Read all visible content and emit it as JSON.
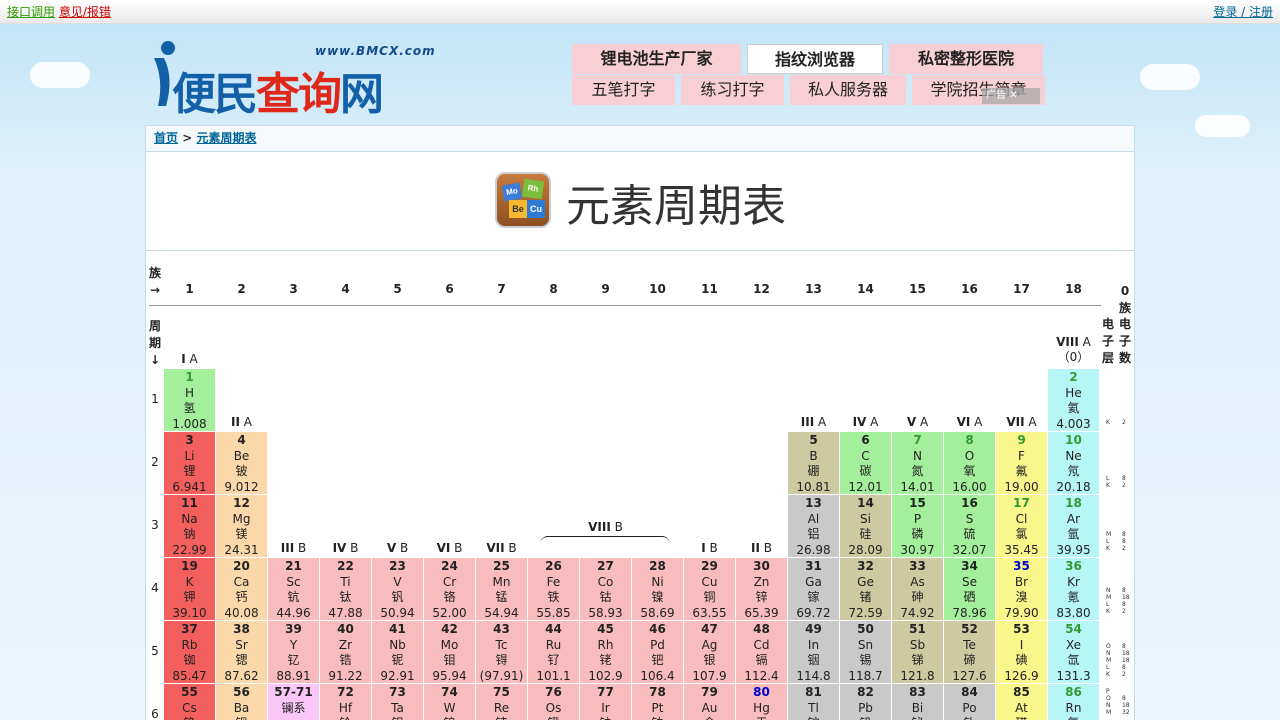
{
  "topbar": {
    "api": "接口调用",
    "feedback": "意见/报错",
    "login": "登录 / 注册"
  },
  "logo": {
    "url": "www.BMCX.com",
    "name_a": "便民",
    "name_b": "查询",
    "name_c": "网"
  },
  "nav": {
    "row1": [
      "锂电池生产厂家",
      "指纹浏览器",
      "私密整形医院"
    ],
    "row2": [
      "五笔打字",
      "练习打字",
      "私人服务器",
      "学院招生简章"
    ],
    "ad_badge": "广告"
  },
  "breadcrumb": {
    "home": "首页",
    "sep": ">",
    "current": "元素周期表"
  },
  "page": {
    "title": "元素周期表"
  },
  "table": {
    "family_label": "族",
    "arrow_right": "→",
    "period_label": "周期",
    "arrow_down": "↓",
    "groups": [
      "1",
      "2",
      "3",
      "4",
      "5",
      "6",
      "7",
      "8",
      "9",
      "10",
      "11",
      "12",
      "13",
      "14",
      "15",
      "16",
      "17",
      "18"
    ],
    "zero_group": "0族",
    "shell_label": "电子层",
    "electron_label": "电子数",
    "group_names": {
      "IA": "I A",
      "IIA": "II A",
      "IIIA": "III A",
      "IVA": "IV A",
      "VA": "V A",
      "VIA": "VI A",
      "VIIA": "VII A",
      "VIIIA": "VIII A",
      "zero": "（0）",
      "IIIB": "III B",
      "IVB": "IV B",
      "VB": "V B",
      "VIB": "VI B",
      "VIIB": "VII B",
      "VIIIB": "VIII B",
      "IB": "I B",
      "IIB": "II B"
    },
    "periods": [
      "1",
      "2",
      "3",
      "4",
      "5",
      "6"
    ],
    "shells": [
      {
        "letters": "K",
        "counts": "2"
      },
      {
        "letters": "L\nK",
        "counts": "8\n2"
      },
      {
        "letters": "M\nL\nK",
        "counts": "8\n8\n2"
      },
      {
        "letters": "N\nM\nL\nK",
        "counts": "8\n18\n8\n2"
      },
      {
        "letters": "O\nN\nM\nL\nK",
        "counts": "8\n18\n18\n8\n2"
      },
      {
        "letters": "P\nO\nN\nM",
        "counts": "8\n18\n32"
      }
    ],
    "elements": [
      {
        "n": "1",
        "s": "H",
        "c": "氢",
        "m": "1.008",
        "row": 1,
        "col": 1,
        "bg": "#a4ef9b",
        "nc": "#393"
      },
      {
        "n": "2",
        "s": "He",
        "c": "氦",
        "m": "4.003",
        "row": 1,
        "col": 18,
        "bg": "#b6f6f7",
        "nc": "#393"
      },
      {
        "n": "3",
        "s": "Li",
        "c": "锂",
        "m": "6.941",
        "row": 2,
        "col": 1,
        "bg": "#f35f5d",
        "nc": "#222"
      },
      {
        "n": "4",
        "s": "Be",
        "c": "铍",
        "m": "9.012",
        "row": 2,
        "col": 2,
        "bg": "#fbd8a9",
        "nc": "#222"
      },
      {
        "n": "5",
        "s": "B",
        "c": "硼",
        "m": "10.81",
        "row": 2,
        "col": 13,
        "bg": "#cdc9a0",
        "nc": "#222"
      },
      {
        "n": "6",
        "s": "C",
        "c": "碳",
        "m": "12.01",
        "row": 2,
        "col": 14,
        "bg": "#a4ef9b",
        "nc": "#222"
      },
      {
        "n": "7",
        "s": "N",
        "c": "氮",
        "m": "14.01",
        "row": 2,
        "col": 15,
        "bg": "#a4ef9b",
        "nc": "#393"
      },
      {
        "n": "8",
        "s": "O",
        "c": "氧",
        "m": "16.00",
        "row": 2,
        "col": 16,
        "bg": "#a4ef9b",
        "nc": "#393"
      },
      {
        "n": "9",
        "s": "F",
        "c": "氟",
        "m": "19.00",
        "row": 2,
        "col": 17,
        "bg": "#f9f78c",
        "nc": "#393"
      },
      {
        "n": "10",
        "s": "Ne",
        "c": "氖",
        "m": "20.18",
        "row": 2,
        "col": 18,
        "bg": "#b6f6f7",
        "nc": "#393"
      },
      {
        "n": "11",
        "s": "Na",
        "c": "钠",
        "m": "22.99",
        "row": 3,
        "col": 1,
        "bg": "#f35f5d",
        "nc": "#222"
      },
      {
        "n": "12",
        "s": "Mg",
        "c": "镁",
        "m": "24.31",
        "row": 3,
        "col": 2,
        "bg": "#fbd8a9",
        "nc": "#222"
      },
      {
        "n": "13",
        "s": "Al",
        "c": "铝",
        "m": "26.98",
        "row": 3,
        "col": 13,
        "bg": "#c9c9c9",
        "nc": "#222"
      },
      {
        "n": "14",
        "s": "Si",
        "c": "硅",
        "m": "28.09",
        "row": 3,
        "col": 14,
        "bg": "#cdc9a0",
        "nc": "#222"
      },
      {
        "n": "15",
        "s": "P",
        "c": "磷",
        "m": "30.97",
        "row": 3,
        "col": 15,
        "bg": "#a4ef9b",
        "nc": "#222"
      },
      {
        "n": "16",
        "s": "S",
        "c": "硫",
        "m": "32.07",
        "row": 3,
        "col": 16,
        "bg": "#a4ef9b",
        "nc": "#222"
      },
      {
        "n": "17",
        "s": "Cl",
        "c": "氯",
        "m": "35.45",
        "row": 3,
        "col": 17,
        "bg": "#f9f78c",
        "nc": "#393"
      },
      {
        "n": "18",
        "s": "Ar",
        "c": "氩",
        "m": "39.95",
        "row": 3,
        "col": 18,
        "bg": "#b6f6f7",
        "nc": "#393"
      },
      {
        "n": "19",
        "s": "K",
        "c": "钾",
        "m": "39.10",
        "row": 4,
        "col": 1,
        "bg": "#f35f5d",
        "nc": "#222"
      },
      {
        "n": "20",
        "s": "Ca",
        "c": "钙",
        "m": "40.08",
        "row": 4,
        "col": 2,
        "bg": "#fbd8a9",
        "nc": "#222"
      },
      {
        "n": "21",
        "s": "Sc",
        "c": "钪",
        "m": "44.96",
        "row": 4,
        "col": 3,
        "bg": "#f9bcbc",
        "nc": "#222"
      },
      {
        "n": "22",
        "s": "Ti",
        "c": "钛",
        "m": "47.88",
        "row": 4,
        "col": 4,
        "bg": "#f9bcbc",
        "nc": "#222"
      },
      {
        "n": "23",
        "s": "V",
        "c": "钒",
        "m": "50.94",
        "row": 4,
        "col": 5,
        "bg": "#f9bcbc",
        "nc": "#222"
      },
      {
        "n": "24",
        "s": "Cr",
        "c": "铬",
        "m": "52.00",
        "row": 4,
        "col": 6,
        "bg": "#f9bcbc",
        "nc": "#222"
      },
      {
        "n": "25",
        "s": "Mn",
        "c": "锰",
        "m": "54.94",
        "row": 4,
        "col": 7,
        "bg": "#f9bcbc",
        "nc": "#222"
      },
      {
        "n": "26",
        "s": "Fe",
        "c": "铁",
        "m": "55.85",
        "row": 4,
        "col": 8,
        "bg": "#f9bcbc",
        "nc": "#222"
      },
      {
        "n": "27",
        "s": "Co",
        "c": "钴",
        "m": "58.93",
        "row": 4,
        "col": 9,
        "bg": "#f9bcbc",
        "nc": "#222"
      },
      {
        "n": "28",
        "s": "Ni",
        "c": "镍",
        "m": "58.69",
        "row": 4,
        "col": 10,
        "bg": "#f9bcbc",
        "nc": "#222"
      },
      {
        "n": "29",
        "s": "Cu",
        "c": "铜",
        "m": "63.55",
        "row": 4,
        "col": 11,
        "bg": "#f9bcbc",
        "nc": "#222"
      },
      {
        "n": "30",
        "s": "Zn",
        "c": "锌",
        "m": "65.39",
        "row": 4,
        "col": 12,
        "bg": "#f9bcbc",
        "nc": "#222"
      },
      {
        "n": "31",
        "s": "Ga",
        "c": "镓",
        "m": "69.72",
        "row": 4,
        "col": 13,
        "bg": "#c9c9c9",
        "nc": "#222"
      },
      {
        "n": "32",
        "s": "Ge",
        "c": "锗",
        "m": "72.59",
        "row": 4,
        "col": 14,
        "bg": "#cdc9a0",
        "nc": "#222"
      },
      {
        "n": "33",
        "s": "As",
        "c": "砷",
        "m": "74.92",
        "row": 4,
        "col": 15,
        "bg": "#cdc9a0",
        "nc": "#222"
      },
      {
        "n": "34",
        "s": "Se",
        "c": "硒",
        "m": "78.96",
        "row": 4,
        "col": 16,
        "bg": "#a4ef9b",
        "nc": "#222"
      },
      {
        "n": "35",
        "s": "Br",
        "c": "溴",
        "m": "79.90",
        "row": 4,
        "col": 17,
        "bg": "#f9f78c",
        "nc": "#00c"
      },
      {
        "n": "36",
        "s": "Kr",
        "c": "氪",
        "m": "83.80",
        "row": 4,
        "col": 18,
        "bg": "#b6f6f7",
        "nc": "#393"
      },
      {
        "n": "37",
        "s": "Rb",
        "c": "铷",
        "m": "85.47",
        "row": 5,
        "col": 1,
        "bg": "#f35f5d",
        "nc": "#222"
      },
      {
        "n": "38",
        "s": "Sr",
        "c": "锶",
        "m": "87.62",
        "row": 5,
        "col": 2,
        "bg": "#fbd8a9",
        "nc": "#222"
      },
      {
        "n": "39",
        "s": "Y",
        "c": "钇",
        "m": "88.91",
        "row": 5,
        "col": 3,
        "bg": "#f9bcbc",
        "nc": "#222"
      },
      {
        "n": "40",
        "s": "Zr",
        "c": "锆",
        "m": "91.22",
        "row": 5,
        "col": 4,
        "bg": "#f9bcbc",
        "nc": "#222"
      },
      {
        "n": "41",
        "s": "Nb",
        "c": "铌",
        "m": "92.91",
        "row": 5,
        "col": 5,
        "bg": "#f9bcbc",
        "nc": "#222"
      },
      {
        "n": "42",
        "s": "Mo",
        "c": "钼",
        "m": "95.94",
        "row": 5,
        "col": 6,
        "bg": "#f9bcbc",
        "nc": "#222"
      },
      {
        "n": "43",
        "s": "Tc",
        "c": "锝",
        "m": "(97.91)",
        "row": 5,
        "col": 7,
        "bg": "#f9bcbc",
        "nc": "#222"
      },
      {
        "n": "44",
        "s": "Ru",
        "c": "钌",
        "m": "101.1",
        "row": 5,
        "col": 8,
        "bg": "#f9bcbc",
        "nc": "#222"
      },
      {
        "n": "45",
        "s": "Rh",
        "c": "铑",
        "m": "102.9",
        "row": 5,
        "col": 9,
        "bg": "#f9bcbc",
        "nc": "#222"
      },
      {
        "n": "46",
        "s": "Pd",
        "c": "钯",
        "m": "106.4",
        "row": 5,
        "col": 10,
        "bg": "#f9bcbc",
        "nc": "#222"
      },
      {
        "n": "47",
        "s": "Ag",
        "c": "银",
        "m": "107.9",
        "row": 5,
        "col": 11,
        "bg": "#f9bcbc",
        "nc": "#222"
      },
      {
        "n": "48",
        "s": "Cd",
        "c": "镉",
        "m": "112.4",
        "row": 5,
        "col": 12,
        "bg": "#f9bcbc",
        "nc": "#222"
      },
      {
        "n": "49",
        "s": "In",
        "c": "铟",
        "m": "114.8",
        "row": 5,
        "col": 13,
        "bg": "#c9c9c9",
        "nc": "#222"
      },
      {
        "n": "50",
        "s": "Sn",
        "c": "锡",
        "m": "118.7",
        "row": 5,
        "col": 14,
        "bg": "#c9c9c9",
        "nc": "#222"
      },
      {
        "n": "51",
        "s": "Sb",
        "c": "锑",
        "m": "121.8",
        "row": 5,
        "col": 15,
        "bg": "#cdc9a0",
        "nc": "#222"
      },
      {
        "n": "52",
        "s": "Te",
        "c": "碲",
        "m": "127.6",
        "row": 5,
        "col": 16,
        "bg": "#cdc9a0",
        "nc": "#222"
      },
      {
        "n": "53",
        "s": "I",
        "c": "碘",
        "m": "126.9",
        "row": 5,
        "col": 17,
        "bg": "#f9f78c",
        "nc": "#222"
      },
      {
        "n": "54",
        "s": "Xe",
        "c": "氙",
        "m": "131.3",
        "row": 5,
        "col": 18,
        "bg": "#b6f6f7",
        "nc": "#393"
      },
      {
        "n": "55",
        "s": "Cs",
        "c": "铯",
        "m": "",
        "row": 6,
        "col": 1,
        "bg": "#f35f5d",
        "nc": "#222"
      },
      {
        "n": "56",
        "s": "Ba",
        "c": "钡",
        "m": "",
        "row": 6,
        "col": 2,
        "bg": "#fbd8a9",
        "nc": "#222"
      },
      {
        "n": "57-71",
        "s": "镧系",
        "c": "",
        "m": "",
        "row": 6,
        "col": 3,
        "bg": "#f9c6f7",
        "nc": "#222"
      },
      {
        "n": "72",
        "s": "Hf",
        "c": "铪",
        "m": "",
        "row": 6,
        "col": 4,
        "bg": "#f9bcbc",
        "nc": "#222"
      },
      {
        "n": "73",
        "s": "Ta",
        "c": "钽",
        "m": "",
        "row": 6,
        "col": 5,
        "bg": "#f9bcbc",
        "nc": "#222"
      },
      {
        "n": "74",
        "s": "W",
        "c": "钨",
        "m": "",
        "row": 6,
        "col": 6,
        "bg": "#f9bcbc",
        "nc": "#222"
      },
      {
        "n": "75",
        "s": "Re",
        "c": "铼",
        "m": "",
        "row": 6,
        "col": 7,
        "bg": "#f9bcbc",
        "nc": "#222"
      },
      {
        "n": "76",
        "s": "Os",
        "c": "锇",
        "m": "",
        "row": 6,
        "col": 8,
        "bg": "#f9bcbc",
        "nc": "#222"
      },
      {
        "n": "77",
        "s": "Ir",
        "c": "铱",
        "m": "",
        "row": 6,
        "col": 9,
        "bg": "#f9bcbc",
        "nc": "#222"
      },
      {
        "n": "78",
        "s": "Pt",
        "c": "铂",
        "m": "",
        "row": 6,
        "col": 10,
        "bg": "#f9bcbc",
        "nc": "#222"
      },
      {
        "n": "79",
        "s": "Au",
        "c": "金",
        "m": "",
        "row": 6,
        "col": 11,
        "bg": "#f9bcbc",
        "nc": "#222"
      },
      {
        "n": "80",
        "s": "Hg",
        "c": "汞",
        "m": "",
        "row": 6,
        "col": 12,
        "bg": "#f9bcbc",
        "nc": "#00c"
      },
      {
        "n": "81",
        "s": "Tl",
        "c": "铊",
        "m": "",
        "row": 6,
        "col": 13,
        "bg": "#c9c9c9",
        "nc": "#222"
      },
      {
        "n": "82",
        "s": "Pb",
        "c": "铅",
        "m": "",
        "row": 6,
        "col": 14,
        "bg": "#c9c9c9",
        "nc": "#222"
      },
      {
        "n": "83",
        "s": "Bi",
        "c": "铋",
        "m": "",
        "row": 6,
        "col": 15,
        "bg": "#c9c9c9",
        "nc": "#222"
      },
      {
        "n": "84",
        "s": "Po",
        "c": "钋",
        "m": "",
        "row": 6,
        "col": 16,
        "bg": "#c9c9c9",
        "nc": "#222"
      },
      {
        "n": "85",
        "s": "At",
        "c": "砹",
        "m": "",
        "row": 6,
        "col": 17,
        "bg": "#f9f78c",
        "nc": "#222"
      },
      {
        "n": "86",
        "s": "Rn",
        "c": "氡",
        "m": "",
        "row": 6,
        "col": 18,
        "bg": "#b6f6f7",
        "nc": "#393"
      }
    ]
  }
}
